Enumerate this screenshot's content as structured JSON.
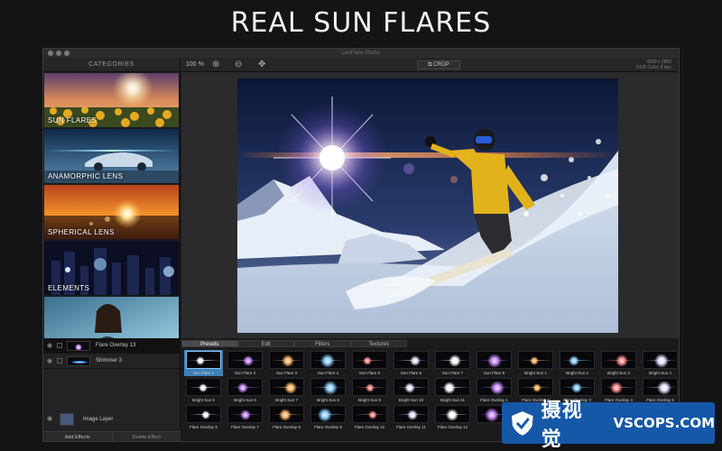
{
  "hero": {
    "title": "REAL SUN FLARES"
  },
  "window": {
    "title": "LenFlare Studio"
  },
  "toolbar": {
    "categories_header": "CATEGORIES",
    "zoom": "100 %",
    "crop_label": "CROP",
    "image_size": "4200 x 2800",
    "color_info": "RGB Color, 8 bpc"
  },
  "categories": [
    {
      "label": "SUN FLARES"
    },
    {
      "label": "ANAMORPHIC LENS"
    },
    {
      "label": "SPHERICAL LENS"
    },
    {
      "label": "ELEMENTS"
    },
    {
      "label": ""
    }
  ],
  "layers": [
    {
      "name": "Flare Overlay 13"
    },
    {
      "name": "Shimmer 3"
    }
  ],
  "image_layer": {
    "name": "Image Layer"
  },
  "layer_actions": {
    "add": "Add Effects",
    "delete": "Delete Effect"
  },
  "tabs": [
    "Presets",
    "Edit",
    "Filters",
    "Textures"
  ],
  "presets": [
    "Sun Flare 1",
    "Sun Flare 2",
    "Sun Flare 3",
    "Sun Flare 4",
    "Sun Flare 5",
    "Sun Flare 6",
    "Sun Flare 7",
    "Sun Flare 8",
    "Bright Sun 1",
    "Bright Sun 2",
    "Bright Sun 3",
    "Bright Sun 4",
    "Bright Sun 5",
    "Bright Sun 6",
    "Bright Sun 7",
    "Bright Sun 8",
    "Bright Sun 9",
    "Bright Sun 10",
    "Bright Sun 11",
    "Flare Overlay 1",
    "Flare Overlay 2",
    "Flare Overlay 3",
    "Flare Overlay 4",
    "Flare Overlay 5",
    "Flare Overlay 6",
    "Flare Overlay 7",
    "Flare Overlay 8",
    "Flare Overlay 9",
    "Flare Overlay 10",
    "Flare Overlay 11",
    "Flare Overlay 12",
    "",
    "",
    "",
    "",
    ""
  ],
  "watermark": {
    "cn": "摄视觉",
    "en": "VSCOPS.COM"
  }
}
